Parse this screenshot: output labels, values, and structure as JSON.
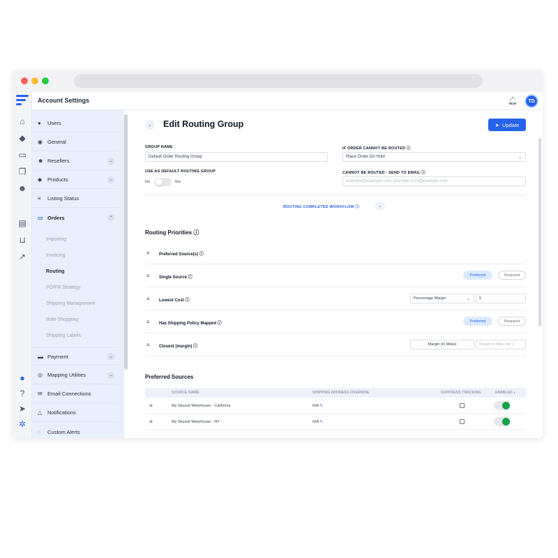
{
  "header": {
    "title": "Account Settings",
    "avatar_initials": "TD"
  },
  "sidebar": {
    "items": [
      {
        "label": "Users",
        "icon": "user-icon"
      },
      {
        "label": "General",
        "icon": "globe-icon"
      },
      {
        "label": "Resellers",
        "icon": "people-icon"
      },
      {
        "label": "Products",
        "icon": "tag-icon"
      },
      {
        "label": "Listing Status",
        "icon": "list-icon"
      },
      {
        "label": "Orders",
        "icon": "inbox-icon"
      }
    ],
    "orders_sub": [
      "Importing",
      "Invoicing",
      "Routing",
      "PO/FR Strategy",
      "Shipping Management",
      "Rate Shopping",
      "Shipping Labels"
    ],
    "lower_items": [
      {
        "label": "Payment",
        "icon": "card-icon"
      },
      {
        "label": "Mapping Utilities",
        "icon": "target-icon"
      },
      {
        "label": "Email Connections",
        "icon": "mail-icon"
      },
      {
        "label": "Notifications",
        "icon": "bell-icon"
      },
      {
        "label": "Custom Alerts",
        "icon": "chat-icon"
      }
    ]
  },
  "page": {
    "title": "Edit Routing Group",
    "update_label": "Update",
    "group_name_label": "GROUP NAME",
    "group_name_value": "Default Order Routing Group",
    "cannot_route_label": "IF ORDER CANNOT BE ROUTED",
    "cannot_route_value": "Place Order On Hold",
    "default_group_label": "USE AS DEFAULT ROUTING GROUP",
    "toggle_no": "No",
    "toggle_yes": "Yes",
    "email_label": "CANNOT BE ROUTED - SEND TO EMAIL",
    "email_placeholder": "example@example.com, example+123@example.com",
    "workflow_label": "ROUTING COMPLETED WORKFLOW"
  },
  "priorities": {
    "title": "Routing Priorities",
    "rows": [
      {
        "label": "Preferred Source(s)"
      },
      {
        "label": "Single Source",
        "pref": "Preferred",
        "req": "Required"
      },
      {
        "label": "Lowest Cost",
        "select": "Percentage Margin",
        "amount": "5"
      },
      {
        "label": "Has Shipping Policy Mapped",
        "pref": "Preferred",
        "req": "Required"
      },
      {
        "label": "Closest (margin)",
        "margin_label": "Margin (In Miles)",
        "margin_placeholder": "Margin in Miles for c"
      }
    ]
  },
  "sources": {
    "title": "Preferred Sources",
    "columns": [
      "SOURCE NAME",
      "SHIPPING ADDRESS OVERRIDE",
      "SUPPRESS TRACKING",
      "ENABLED"
    ],
    "rows": [
      {
        "name": "My Skusuit Warehouse - California",
        "override": "N/A"
      },
      {
        "name": "My Skusuit Warehouse - NY",
        "override": "N/A"
      }
    ]
  },
  "colors": {
    "accent": "#2563eb",
    "enabled": "#16a34a",
    "sidebar": "#e9eefb"
  }
}
